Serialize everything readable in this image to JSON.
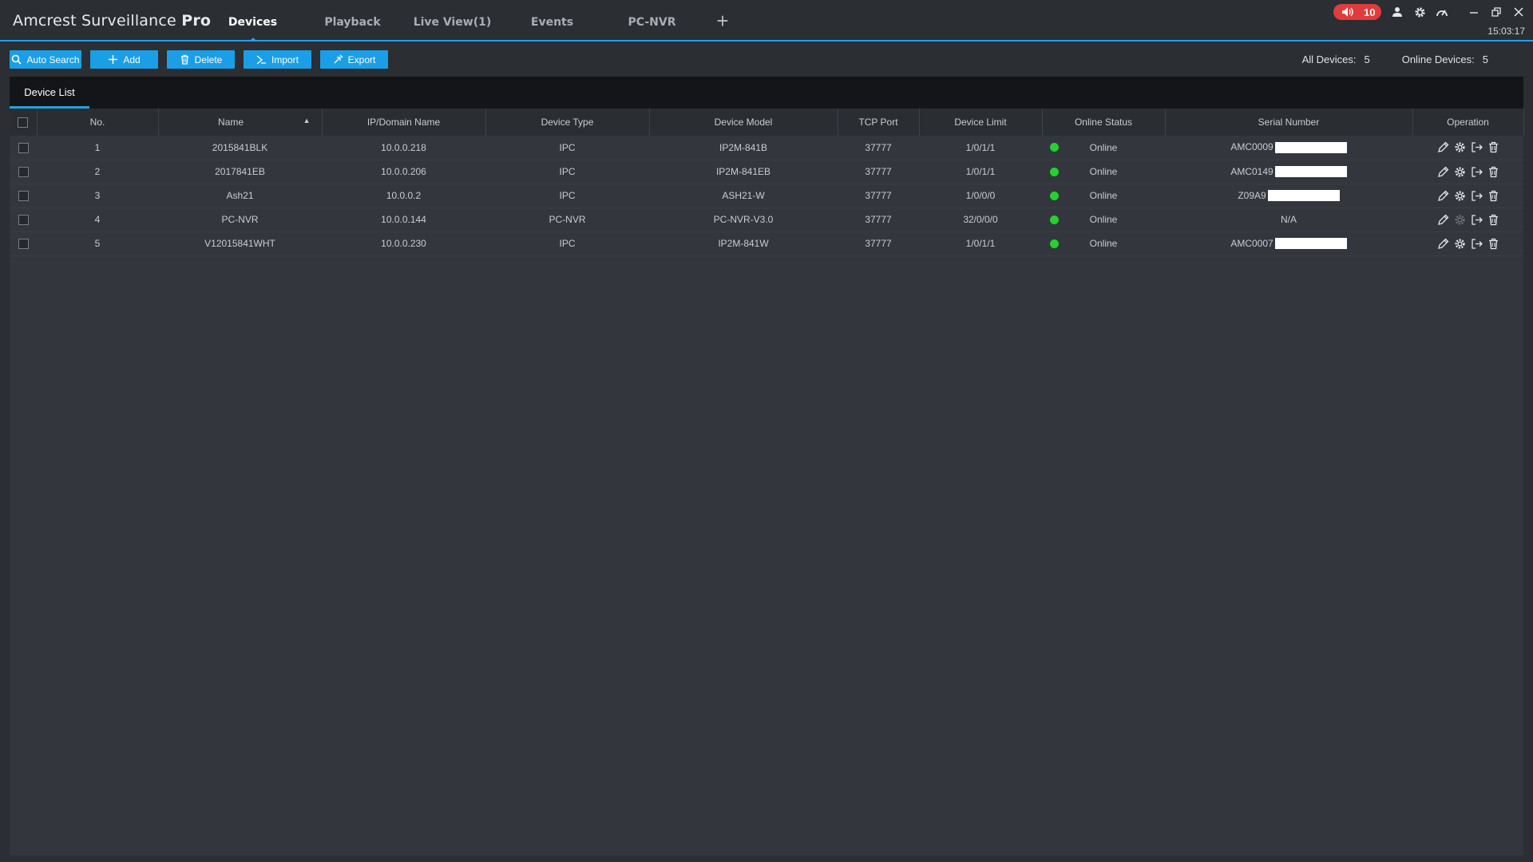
{
  "app": {
    "title_light": "Amcrest Surveillance",
    "title_bold": "Pro",
    "clock": "15:03:17"
  },
  "nav": {
    "tabs": [
      {
        "label": "Devices",
        "active": true
      },
      {
        "label": "Playback"
      },
      {
        "label": "Live View(1)"
      },
      {
        "label": "Events"
      },
      {
        "label": "PC-NVR"
      }
    ],
    "add_label": "+"
  },
  "alarm": {
    "count": "10"
  },
  "toolbar": {
    "auto_search": "Auto Search",
    "add": "Add",
    "delete": "Delete",
    "import": "Import",
    "export": "Export"
  },
  "counts": {
    "all_label": "All Devices:",
    "all_value": "5",
    "online_label": "Online Devices:",
    "online_value": "5"
  },
  "subtab": {
    "label": "Device List"
  },
  "table": {
    "headers": {
      "no": "No.",
      "name": "Name",
      "ip": "IP/Domain Name",
      "type": "Device Type",
      "model": "Device Model",
      "port": "TCP Port",
      "limit": "Device Limit",
      "status": "Online Status",
      "serial": "Serial Number",
      "operation": "Operation"
    },
    "rows": [
      {
        "no": "1",
        "name": "2015841BLK",
        "ip": "10.0.0.218",
        "type": "IPC",
        "model": "IP2M-841B",
        "port": "37777",
        "limit": "1/0/1/1",
        "status": "Online",
        "serial": "AMC0009",
        "redacted": true
      },
      {
        "no": "2",
        "name": "2017841EB",
        "ip": "10.0.0.206",
        "type": "IPC",
        "model": "IP2M-841EB",
        "port": "37777",
        "limit": "1/0/1/1",
        "status": "Online",
        "serial": "AMC0149",
        "redacted": true
      },
      {
        "no": "3",
        "name": "Ash21",
        "ip": "10.0.0.2",
        "type": "IPC",
        "model": "ASH21-W",
        "port": "37777",
        "limit": "1/0/0/0",
        "status": "Online",
        "serial": "Z09A9",
        "redacted": true
      },
      {
        "no": "4",
        "name": "PC-NVR",
        "ip": "10.0.0.144",
        "type": "PC-NVR",
        "model": "PC-NVR-V3.0",
        "port": "37777",
        "limit": "32/0/0/0",
        "status": "Online",
        "serial": "N/A",
        "redacted": false
      },
      {
        "no": "5",
        "name": "V12015841WHT",
        "ip": "10.0.0.230",
        "type": "IPC",
        "model": "IP2M-841W",
        "port": "37777",
        "limit": "1/0/1/1",
        "status": "Online",
        "serial": "AMC0007",
        "redacted": true
      }
    ]
  },
  "colors": {
    "accent": "#1fa3e3",
    "button": "#1a9fe6",
    "online": "#22d32b",
    "alarm": "#e23b3b"
  },
  "icons": [
    "speaker-icon",
    "user-icon",
    "gear-icon",
    "speedometer-icon",
    "minimize-icon",
    "restore-icon",
    "close-icon",
    "search-icon",
    "plus-icon",
    "trash-icon",
    "import-icon",
    "export-icon",
    "edit-icon",
    "settings-icon",
    "logout-icon"
  ]
}
